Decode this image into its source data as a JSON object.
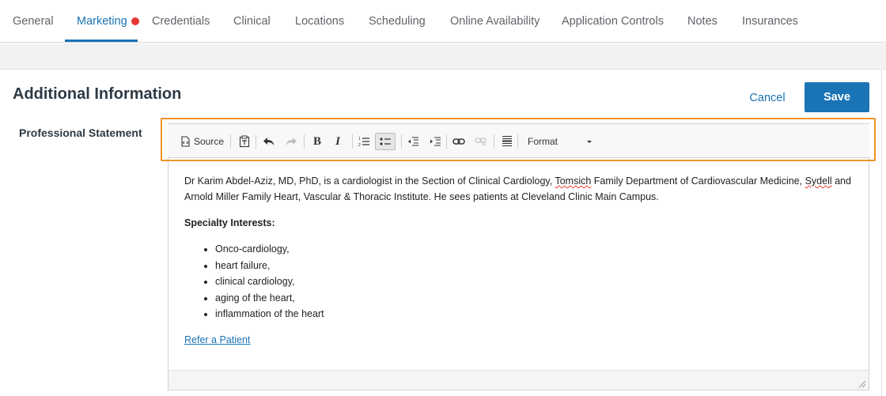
{
  "tabs": [
    {
      "label": "General"
    },
    {
      "label": "Marketing"
    },
    {
      "label": "Credentials"
    },
    {
      "label": "Clinical"
    },
    {
      "label": "Locations"
    },
    {
      "label": "Scheduling"
    },
    {
      "label": "Online Availability"
    },
    {
      "label": "Application Controls"
    },
    {
      "label": "Notes"
    },
    {
      "label": "Insurances"
    }
  ],
  "active_tab": "Marketing",
  "section": {
    "title": "Additional Information",
    "cancel_label": "Cancel",
    "save_label": "Save"
  },
  "field": {
    "label": "Professional Statement"
  },
  "toolbar": {
    "source_label": "Source",
    "format_label": "Format",
    "icons": [
      "source-icon",
      "paste-text-icon",
      "undo-icon",
      "redo-icon",
      "bold-icon",
      "italic-icon",
      "numbered-list-icon",
      "bulleted-list-icon",
      "outdent-icon",
      "indent-icon",
      "link-icon",
      "unlink-icon",
      "horizontal-rule-icon",
      "format-dropdown"
    ]
  },
  "editor": {
    "paragraph_pre": "Dr Karim Abdel-Aziz, MD, PhD, is a cardiologist in the Section of Clinical Cardiology, ",
    "paragraph_spell1": "Tomsich",
    "paragraph_mid": " Family Department of Cardiovascular Medicine, ",
    "paragraph_spell2": "Sydell",
    "paragraph_post": " and Arnold Miller Family Heart, Vascular & Thoracic Institute. He sees patients at Cleveland Clinic Main Campus.",
    "specialty_heading": "Specialty Interests:",
    "interests": [
      "Onco-cardiology,",
      "heart failure,",
      "clinical cardiology,",
      "aging of the heart,",
      "inflammation of the heart"
    ],
    "refer_link": "Refer a Patient"
  },
  "colors": {
    "accent": "#1a73b5",
    "dot": "#e53935",
    "focus": "#f0932b"
  }
}
